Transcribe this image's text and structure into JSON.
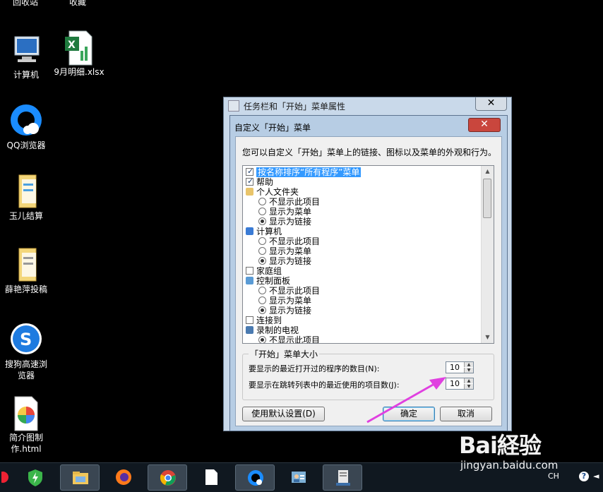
{
  "desktop": {
    "top_labels": [
      "回收站",
      "收藏"
    ],
    "icons": [
      {
        "label": "计算机"
      },
      {
        "label": "9月明细.xlsx"
      },
      {
        "label": "QQ浏览器"
      },
      {
        "label": "玉儿结算"
      },
      {
        "label": "薛艳萍投稿"
      },
      {
        "label": "搜狗高速浏览器"
      },
      {
        "label": "简介图制作.html"
      }
    ]
  },
  "outer_window": {
    "title": "任务栏和「开始」菜单属性",
    "close_glyph": "✕"
  },
  "dialog": {
    "title": "自定义「开始」菜单",
    "close_glyph": "✕",
    "description": "您可以自定义「开始」菜单上的链接、图标以及菜单的外观和行为。",
    "list_items": [
      {
        "type": "checkbox",
        "checked": true,
        "label": "按名称排序“所有程序”菜单",
        "selected": true
      },
      {
        "type": "checkbox",
        "checked": true,
        "label": "帮助"
      },
      {
        "type": "folder",
        "label": "个人文件夹"
      },
      {
        "type": "radio",
        "checked": false,
        "label": "不显示此项目"
      },
      {
        "type": "radio",
        "checked": false,
        "label": "显示为菜单"
      },
      {
        "type": "radio",
        "checked": true,
        "label": "显示为链接"
      },
      {
        "type": "computer",
        "label": "计算机"
      },
      {
        "type": "radio",
        "checked": false,
        "label": "不显示此项目"
      },
      {
        "type": "radio",
        "checked": false,
        "label": "显示为菜单"
      },
      {
        "type": "radio",
        "checked": true,
        "label": "显示为链接"
      },
      {
        "type": "checkbox",
        "checked": false,
        "label": "家庭组"
      },
      {
        "type": "control",
        "label": "控制面板"
      },
      {
        "type": "radio",
        "checked": false,
        "label": "不显示此项目"
      },
      {
        "type": "radio",
        "checked": false,
        "label": "显示为菜单"
      },
      {
        "type": "radio",
        "checked": true,
        "label": "显示为链接"
      },
      {
        "type": "checkbox",
        "checked": false,
        "label": "连接到"
      },
      {
        "type": "tv",
        "label": "录制的电视"
      },
      {
        "type": "radio",
        "checked": true,
        "label": "不显示此项目"
      }
    ],
    "size_group": {
      "title": "「开始」菜单大小",
      "recent_programs_label": "要显示的最近打开过的程序的数目(N):",
      "recent_programs_value": "10",
      "jump_list_label": "要显示在跳转列表中的最近使用的项目数(J):",
      "jump_list_value": "10"
    },
    "buttons": {
      "defaults": "使用默认设置(D)",
      "ok": "确定",
      "cancel": "取消"
    }
  },
  "taskbar": {
    "tray_language": "CH",
    "tray_icons": [
      "help-icon",
      "volume-icon"
    ]
  },
  "watermark": {
    "brand": "Bai経验",
    "url": "jingyan.baidu.com"
  },
  "colors": {
    "selection": "#3399ff",
    "annotation_arrow": "#e040e0",
    "close_red": "#c9463d"
  }
}
